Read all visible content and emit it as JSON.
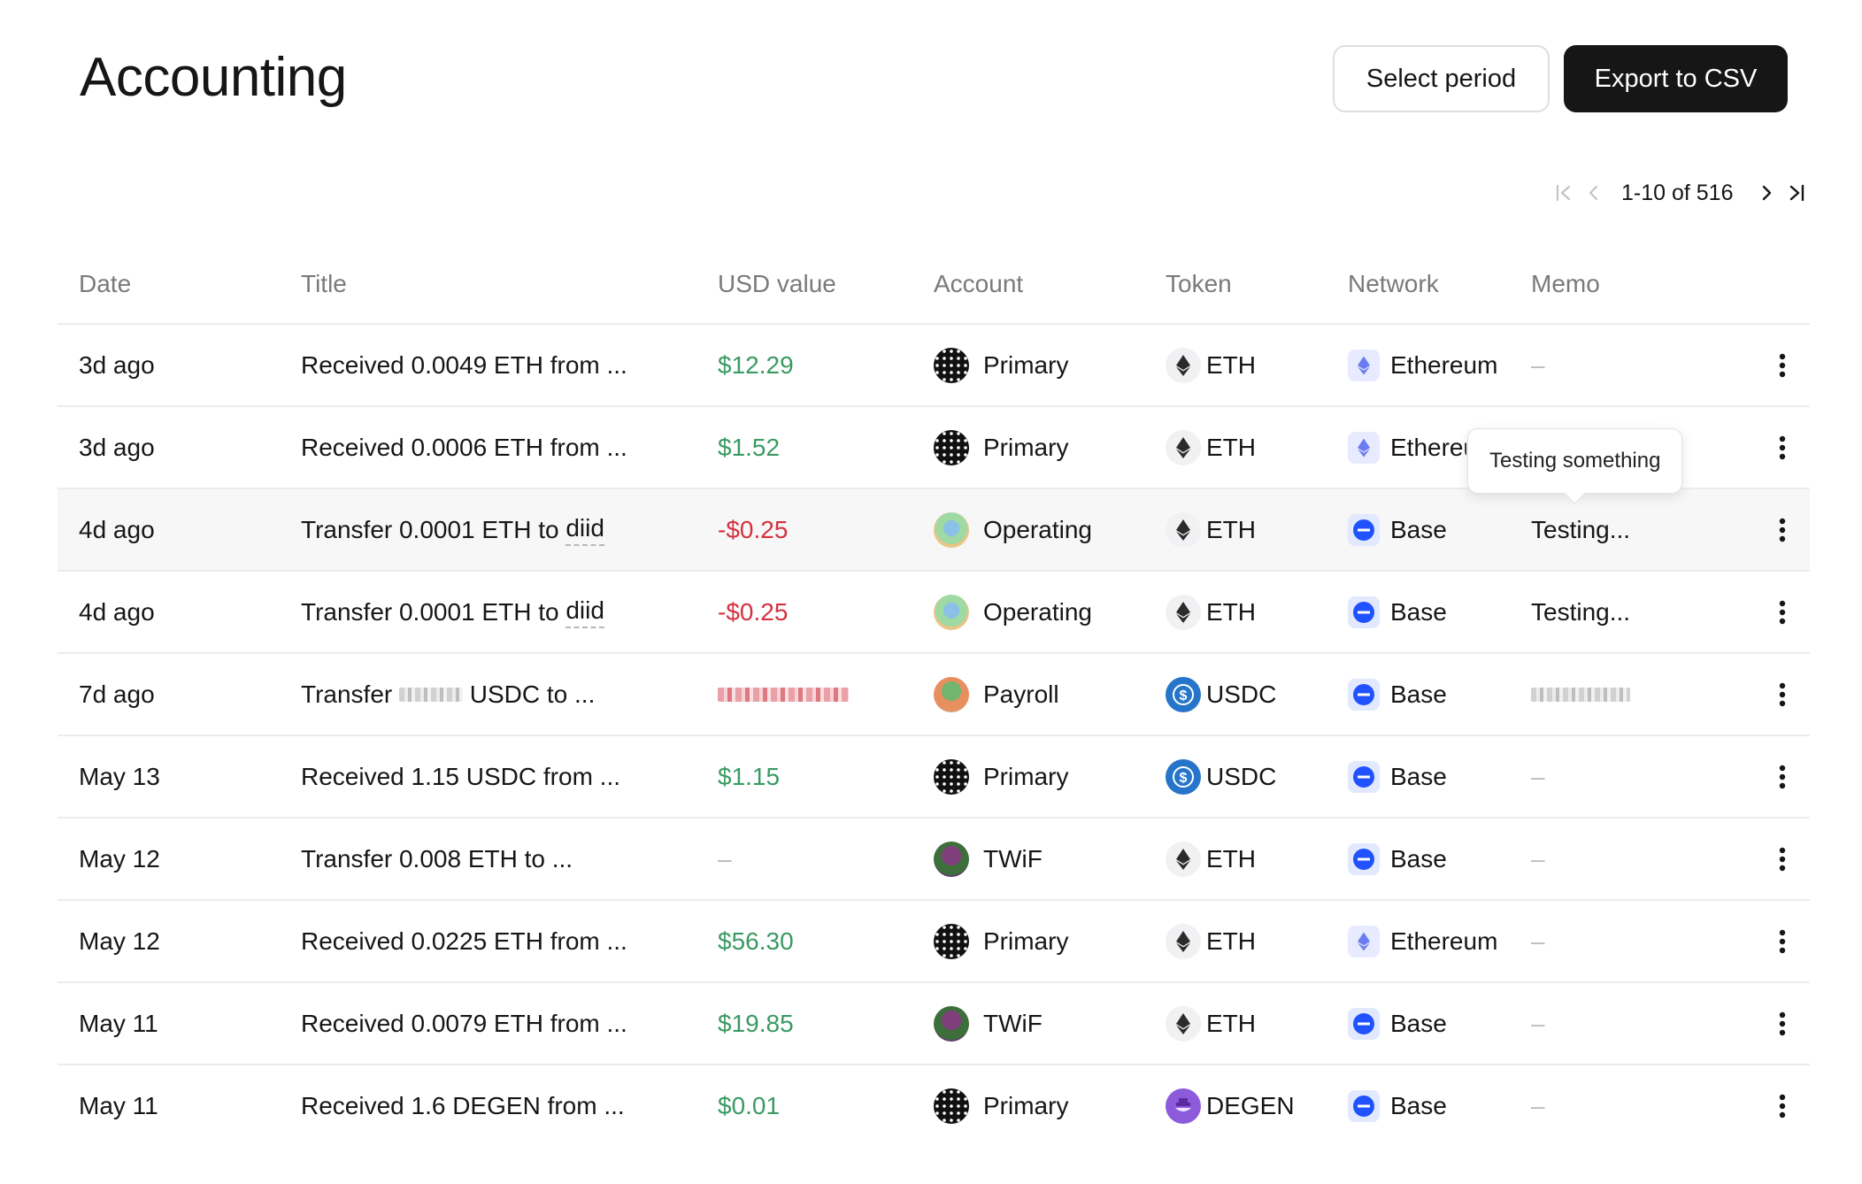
{
  "header": {
    "title": "Accounting",
    "select_period_label": "Select period",
    "export_label": "Export to CSV"
  },
  "pager": {
    "label": "1-10 of 516"
  },
  "columns": {
    "date": "Date",
    "title": "Title",
    "usd": "USD value",
    "account": "Account",
    "token": "Token",
    "network": "Network",
    "memo": "Memo"
  },
  "rows": [
    {
      "date": "3d ago",
      "title": "Received 0.0049 ETH from ...",
      "usd": "$12.29",
      "account": "Primary",
      "token": "ETH",
      "network": "Ethereum",
      "memo": "–"
    },
    {
      "date": "3d ago",
      "title": "Received 0.0006 ETH from ...",
      "usd": "$1.52",
      "account": "Primary",
      "token": "ETH",
      "network": "Ethereum",
      "memo": ""
    },
    {
      "date": "4d ago",
      "title_prefix": "Transfer 0.0001 ETH to",
      "title_link": "diid",
      "usd": "-$0.25",
      "account": "Operating",
      "token": "ETH",
      "network": "Base",
      "memo": "Testing..."
    },
    {
      "date": "4d ago",
      "title_prefix": "Transfer 0.0001 ETH to",
      "title_link": "diid",
      "usd": "-$0.25",
      "account": "Operating",
      "token": "ETH",
      "network": "Base",
      "memo": "Testing..."
    },
    {
      "date": "7d ago",
      "title_prefix": "Transfer",
      "title_suffix": "USDC to ...",
      "usd": "",
      "account": "Payroll",
      "token": "USDC",
      "network": "Base",
      "memo": ""
    },
    {
      "date": "May 13",
      "title": "Received 1.15 USDC from ...",
      "usd": "$1.15",
      "account": "Primary",
      "token": "USDC",
      "network": "Base",
      "memo": "–"
    },
    {
      "date": "May 12",
      "title": "Transfer 0.008 ETH to ...",
      "usd": "–",
      "account": "TWiF",
      "token": "ETH",
      "network": "Base",
      "memo": "–"
    },
    {
      "date": "May 12",
      "title": "Received 0.0225 ETH from ...",
      "usd": "$56.30",
      "account": "Primary",
      "token": "ETH",
      "network": "Ethereum",
      "memo": "–"
    },
    {
      "date": "May 11",
      "title": "Received 0.0079 ETH from ...",
      "usd": "$19.85",
      "account": "TWiF",
      "token": "ETH",
      "network": "Base",
      "memo": "–"
    },
    {
      "date": "May 11",
      "title": "Received 1.6 DEGEN from ...",
      "usd": "$0.01",
      "account": "Primary",
      "token": "DEGEN",
      "network": "Base",
      "memo": "–"
    }
  ],
  "tooltip": {
    "text": "Testing something"
  },
  "colors": {
    "positive": "#3a9a63",
    "negative": "#d4323f",
    "dark_button": "#161616"
  }
}
